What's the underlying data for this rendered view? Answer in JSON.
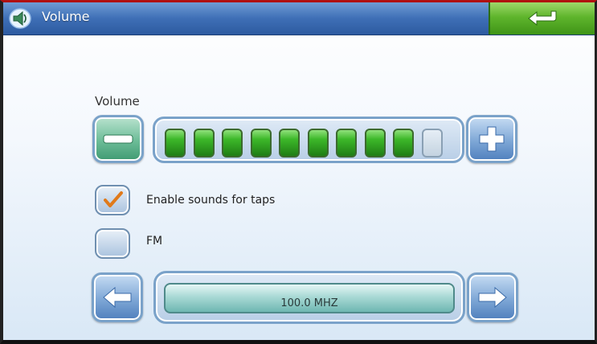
{
  "window": {
    "title": "Volume",
    "icon": "speaker-icon"
  },
  "header": {
    "back_icon": "return-arrow-icon",
    "back_color": "#5fb52c"
  },
  "volume": {
    "label": "Volume",
    "level": 9,
    "max": 10,
    "decrease_icon": "minus-icon",
    "increase_icon": "plus-icon"
  },
  "options": {
    "tap_sounds": {
      "label": "Enable sounds for taps",
      "checked": true
    },
    "fm": {
      "label": "FM",
      "checked": false
    }
  },
  "fm_tuner": {
    "frequency": "100.0 MHZ",
    "prev_icon": "left-arrow-icon",
    "next_icon": "right-arrow-icon"
  }
}
